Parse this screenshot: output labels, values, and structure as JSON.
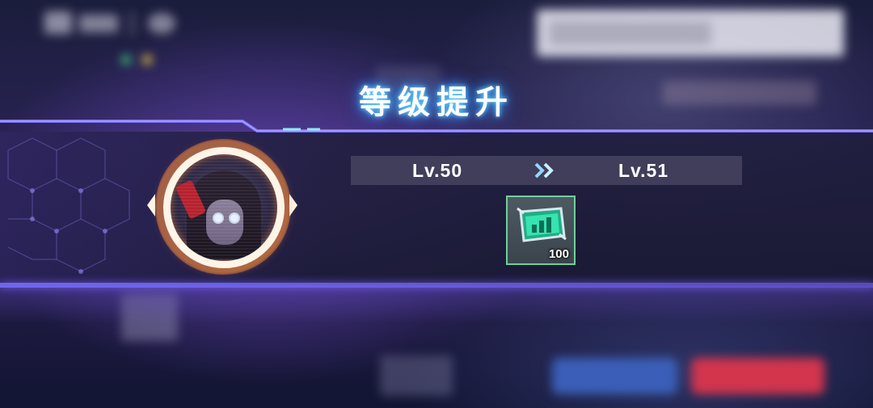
{
  "popup": {
    "title": "等级提升",
    "level_from": "Lv.50",
    "level_to": "Lv.51"
  },
  "reward": {
    "count": "100",
    "icon": "green-data-chip-icon"
  },
  "colors": {
    "title_glow": "#3aa8ff",
    "banner_edge": "#7a6eff",
    "avatar_ring_glow": "#ff8c3c",
    "item_border": "#6fd09a"
  }
}
